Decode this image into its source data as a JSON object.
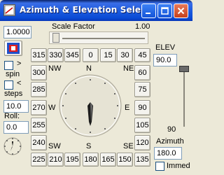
{
  "window": {
    "title": "Azimuth & Elevation Sele..."
  },
  "scale": {
    "value": "1.0000",
    "label": "Scale Factor",
    "max_label": "1.00"
  },
  "spin": {
    "label": "spin",
    "arrow": ">"
  },
  "steps": {
    "label": "steps",
    "arrow": "<",
    "value": "10.0"
  },
  "roll": {
    "label": "Roll:",
    "value": "0.0"
  },
  "azimuth_buttons": {
    "top": [
      "315",
      "330",
      "345",
      "0",
      "15",
      "30",
      "45"
    ],
    "left": [
      "300",
      "285",
      "270",
      "255",
      "240"
    ],
    "right": [
      "60",
      "75",
      "90",
      "105",
      "120"
    ],
    "bottom": [
      "225",
      "210",
      "195",
      "180",
      "165",
      "150",
      "135"
    ]
  },
  "compass": {
    "nw": "NW",
    "n": "N",
    "ne": "NE",
    "w": "W",
    "e": "E",
    "sw": "SW",
    "s": "S",
    "se": "SE"
  },
  "elev": {
    "label": "ELEV",
    "value": "90.0",
    "bottom_label": "90",
    "level": 0
  },
  "azimuth": {
    "label": "Azimuth",
    "value": "180.0"
  },
  "immed": {
    "label": "Immed"
  }
}
